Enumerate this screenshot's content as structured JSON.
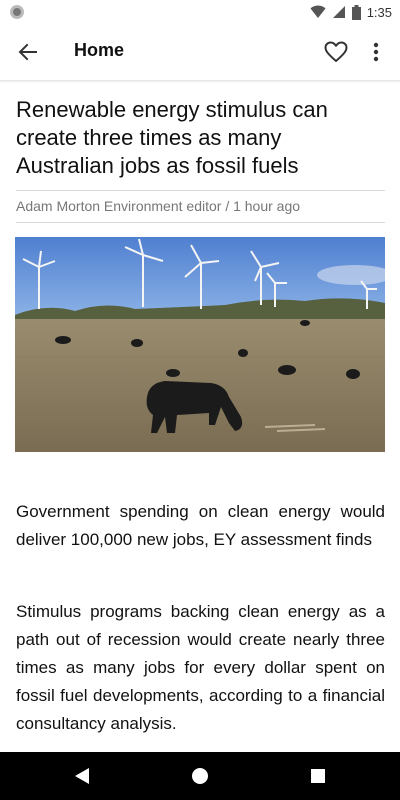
{
  "status_bar": {
    "time": "1:35"
  },
  "app_bar": {
    "title": "Home",
    "back_icon": "arrow-left-icon",
    "favorite_icon": "heart-outline-icon",
    "more_icon": "more-vert-icon"
  },
  "article": {
    "headline": "Renewable energy stimulus can create three times as many Australian jobs as fossil fuels",
    "byline": "Adam Morton Environment editor / 1 hour ago",
    "image_subject": "cattle grazing in front of wind turbines",
    "paragraphs": [
      "Government spending on clean energy would deliver 100,000 new jobs, EY assessment finds",
      "Stimulus programs backing clean energy as a path out of recession would create nearly three times as many jobs for every dollar spent on fossil fuel developments, according to a financial consultancy analysis."
    ]
  },
  "nav_bar": {
    "back_icon": "triangle-back-icon",
    "home_icon": "circle-home-icon",
    "recents_icon": "square-recents-icon"
  }
}
